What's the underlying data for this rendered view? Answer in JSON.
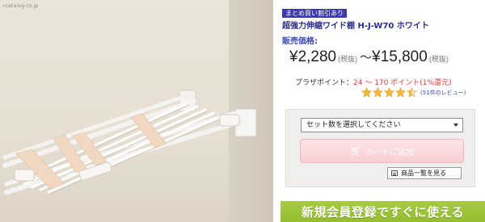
{
  "photo": {
    "watermark": "rcatalog.co.jp",
    "alt_subject": "shelf-product-photo"
  },
  "product": {
    "badge": "まとめ買い割引あり",
    "title": "超強力伸縮ワイド棚 H-J-W70 ホワイト",
    "price_label": "販売価格:",
    "price_min": "¥2,280",
    "price_min_tax": "(税抜)",
    "price_sep": "～",
    "price_max": "¥15,800",
    "price_max_tax": "(税抜)"
  },
  "points": {
    "label": "プラザポイント：",
    "range": "24 ～ 170 ポイント",
    "rate": "(1%還元)"
  },
  "rating": {
    "stars": 4.5,
    "max_stars": 5,
    "review_text": "(51件のレビュー)"
  },
  "cart": {
    "select_value": "セット数を選択してください",
    "add_to_cart_label": "カートに追加",
    "list_button_label": "商品一覧を見る"
  },
  "banner": {
    "text": "新規会員登録ですぐに使える"
  },
  "colors": {
    "badge_bg": "#3b3aa8",
    "points_accent": "#e03a3a",
    "star": "#f2b63a",
    "cart_button": "#f8cfd4",
    "banner_bg": "#9cc43a"
  }
}
